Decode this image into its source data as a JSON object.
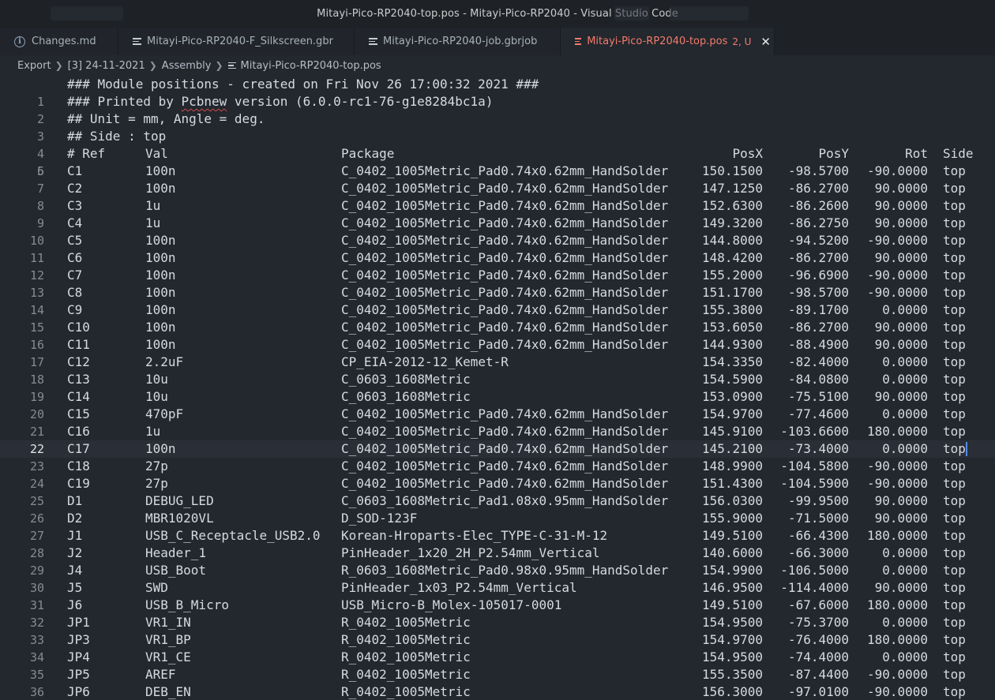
{
  "window": {
    "title": "Mitayi-Pico-RP2040-top.pos - Mitayi-Pico-RP2040 - Visual Studio Code"
  },
  "tabs": [
    {
      "label": "Changes.md",
      "icon": "info-icon",
      "active": false
    },
    {
      "label": "Mitayi-Pico-RP2040-F_Silkscreen.gbr",
      "icon": "file-lines-icon",
      "active": false
    },
    {
      "label": "Mitayi-Pico-RP2040-job.gbrjob",
      "icon": "file-lines-icon",
      "active": false
    },
    {
      "label": "Mitayi-Pico-RP2040-top.pos",
      "icon": "file-lines-icon",
      "active": true,
      "badge": "2, U"
    }
  ],
  "breadcrumb": [
    "Export",
    "[3] 24-11-2021",
    "Assembly",
    "Mitayi-Pico-RP2040-top.pos"
  ],
  "header_lines": [
    {
      "n": "1",
      "text": "### Module positions - created on Fri Nov 26 17:00:32 2021 ###"
    },
    {
      "n": "2",
      "pre": "### Printed by ",
      "squig": "Pcbnew",
      "post": " version (6.0.0-rc1-76-g1e8284bc1a)"
    },
    {
      "n": "3",
      "text": "## Unit = mm, Angle = deg."
    },
    {
      "n": "4",
      "text": "## Side : top"
    }
  ],
  "column_header": {
    "n": "5",
    "ref": "# Ref",
    "val": "Val",
    "pkg": "Package",
    "posx": "PosX",
    "posy": "PosY",
    "rot": "Rot",
    "side": "Side"
  },
  "rows": [
    {
      "n": "6",
      "ref": "C1",
      "val": "100n",
      "pkg": "C_0402_1005Metric_Pad0.74x0.62mm_HandSolder",
      "posx": "150.1500",
      "posy": "-98.5700",
      "rot": "-90.0000",
      "side": "top"
    },
    {
      "n": "7",
      "ref": "C2",
      "val": "100n",
      "pkg": "C_0402_1005Metric_Pad0.74x0.62mm_HandSolder",
      "posx": "147.1250",
      "posy": "-86.2700",
      "rot": "90.0000",
      "side": "top"
    },
    {
      "n": "8",
      "ref": "C3",
      "val": "1u",
      "pkg": "C_0402_1005Metric_Pad0.74x0.62mm_HandSolder",
      "posx": "152.6300",
      "posy": "-86.2600",
      "rot": "90.0000",
      "side": "top"
    },
    {
      "n": "9",
      "ref": "C4",
      "val": "1u",
      "pkg": "C_0402_1005Metric_Pad0.74x0.62mm_HandSolder",
      "posx": "149.3200",
      "posy": "-86.2750",
      "rot": "90.0000",
      "side": "top"
    },
    {
      "n": "10",
      "ref": "C5",
      "val": "100n",
      "pkg": "C_0402_1005Metric_Pad0.74x0.62mm_HandSolder",
      "posx": "144.8000",
      "posy": "-94.5200",
      "rot": "-90.0000",
      "side": "top"
    },
    {
      "n": "11",
      "ref": "C6",
      "val": "100n",
      "pkg": "C_0402_1005Metric_Pad0.74x0.62mm_HandSolder",
      "posx": "148.4200",
      "posy": "-86.2700",
      "rot": "90.0000",
      "side": "top"
    },
    {
      "n": "12",
      "ref": "C7",
      "val": "100n",
      "pkg": "C_0402_1005Metric_Pad0.74x0.62mm_HandSolder",
      "posx": "155.2000",
      "posy": "-96.6900",
      "rot": "-90.0000",
      "side": "top"
    },
    {
      "n": "13",
      "ref": "C8",
      "val": "100n",
      "pkg": "C_0402_1005Metric_Pad0.74x0.62mm_HandSolder",
      "posx": "151.1700",
      "posy": "-98.5700",
      "rot": "-90.0000",
      "side": "top"
    },
    {
      "n": "14",
      "ref": "C9",
      "val": "100n",
      "pkg": "C_0402_1005Metric_Pad0.74x0.62mm_HandSolder",
      "posx": "155.3800",
      "posy": "-89.1700",
      "rot": "0.0000",
      "side": "top"
    },
    {
      "n": "15",
      "ref": "C10",
      "val": "100n",
      "pkg": "C_0402_1005Metric_Pad0.74x0.62mm_HandSolder",
      "posx": "153.6050",
      "posy": "-86.2700",
      "rot": "90.0000",
      "side": "top"
    },
    {
      "n": "16",
      "ref": "C11",
      "val": "100n",
      "pkg": "C_0402_1005Metric_Pad0.74x0.62mm_HandSolder",
      "posx": "144.9300",
      "posy": "-88.4900",
      "rot": "90.0000",
      "side": "top"
    },
    {
      "n": "17",
      "ref": "C12",
      "val": "2.2uF",
      "pkg": "CP_EIA-2012-12_Kemet-R",
      "posx": "154.3350",
      "posy": "-82.4000",
      "rot": "0.0000",
      "side": "top"
    },
    {
      "n": "18",
      "ref": "C13",
      "val": "10u",
      "pkg": "C_0603_1608Metric",
      "posx": "154.5900",
      "posy": "-84.0800",
      "rot": "0.0000",
      "side": "top"
    },
    {
      "n": "19",
      "ref": "C14",
      "val": "10u",
      "pkg": "C_0603_1608Metric",
      "posx": "153.0900",
      "posy": "-75.5100",
      "rot": "90.0000",
      "side": "top"
    },
    {
      "n": "20",
      "ref": "C15",
      "val": "470pF",
      "pkg": "C_0402_1005Metric_Pad0.74x0.62mm_HandSolder",
      "posx": "154.9700",
      "posy": "-77.4600",
      "rot": "0.0000",
      "side": "top"
    },
    {
      "n": "21",
      "ref": "C16",
      "val": "1u",
      "pkg": "C_0402_1005Metric_Pad0.74x0.62mm_HandSolder",
      "posx": "145.9100",
      "posy": "-103.6600",
      "rot": "180.0000",
      "side": "top"
    },
    {
      "n": "22",
      "ref": "C17",
      "val": "100n",
      "pkg": "C_0402_1005Metric_Pad0.74x0.62mm_HandSolder",
      "posx": "145.2100",
      "posy": "-73.4000",
      "rot": "0.0000",
      "side": "top",
      "current": true
    },
    {
      "n": "23",
      "ref": "C18",
      "val": "27p",
      "pkg": "C_0402_1005Metric_Pad0.74x0.62mm_HandSolder",
      "posx": "148.9900",
      "posy": "-104.5800",
      "rot": "-90.0000",
      "side": "top"
    },
    {
      "n": "24",
      "ref": "C19",
      "val": "27p",
      "pkg": "C_0402_1005Metric_Pad0.74x0.62mm_HandSolder",
      "posx": "151.4300",
      "posy": "-104.5900",
      "rot": "-90.0000",
      "side": "top"
    },
    {
      "n": "25",
      "ref": "D1",
      "val": "DEBUG_LED",
      "pkg": "C_0603_1608Metric_Pad1.08x0.95mm_HandSolder",
      "posx": "156.0300",
      "posy": "-99.9500",
      "rot": "90.0000",
      "side": "top"
    },
    {
      "n": "26",
      "ref": "D2",
      "val": "MBR1020VL",
      "pkg": "D_SOD-123F",
      "posx": "155.9000",
      "posy": "-71.5000",
      "rot": "90.0000",
      "side": "top"
    },
    {
      "n": "27",
      "ref": "J1",
      "val": "USB_C_Receptacle_USB2.0",
      "pkg": "Korean-Hroparts-Elec_TYPE-C-31-M-12",
      "posx": "149.5100",
      "posy": "-66.4300",
      "rot": "180.0000",
      "side": "top"
    },
    {
      "n": "28",
      "ref": "J2",
      "val": "Header_1",
      "pkg": "PinHeader_1x20_2H_P2.54mm_Vertical",
      "posx": "140.6000",
      "posy": "-66.3000",
      "rot": "0.0000",
      "side": "top"
    },
    {
      "n": "29",
      "ref": "J4",
      "val": "USB_Boot",
      "pkg": "R_0603_1608Metric_Pad0.98x0.95mm_HandSolder",
      "posx": "154.9900",
      "posy": "-106.5000",
      "rot": "0.0000",
      "side": "top"
    },
    {
      "n": "30",
      "ref": "J5",
      "val": "SWD",
      "pkg": "PinHeader_1x03_P2.54mm_Vertical",
      "posx": "146.9500",
      "posy": "-114.4000",
      "rot": "90.0000",
      "side": "top"
    },
    {
      "n": "31",
      "ref": "J6",
      "val": "USB_B_Micro",
      "pkg": "USB_Micro-B_Molex-105017-0001",
      "posx": "149.5100",
      "posy": "-67.6000",
      "rot": "180.0000",
      "side": "top"
    },
    {
      "n": "32",
      "ref": "JP1",
      "val": "VR1_IN",
      "pkg": "R_0402_1005Metric",
      "posx": "154.9500",
      "posy": "-75.3700",
      "rot": "0.0000",
      "side": "top"
    },
    {
      "n": "33",
      "ref": "JP3",
      "val": "VR1_BP",
      "pkg": "R_0402_1005Metric",
      "posx": "154.9700",
      "posy": "-76.4000",
      "rot": "180.0000",
      "side": "top"
    },
    {
      "n": "34",
      "ref": "JP4",
      "val": "VR1_CE",
      "pkg": "R_0402_1005Metric",
      "posx": "154.9500",
      "posy": "-74.4000",
      "rot": "0.0000",
      "side": "top"
    },
    {
      "n": "35",
      "ref": "JP5",
      "val": "AREF",
      "pkg": "R_0402_1005Metric",
      "posx": "155.3500",
      "posy": "-87.4400",
      "rot": "-90.0000",
      "side": "top"
    },
    {
      "n": "36",
      "ref": "JP6",
      "val": "DEB_EN",
      "pkg": "R_0402_1005Metric",
      "posx": "156.3000",
      "posy": "-97.0100",
      "rot": "-90.0000",
      "side": "top"
    }
  ]
}
